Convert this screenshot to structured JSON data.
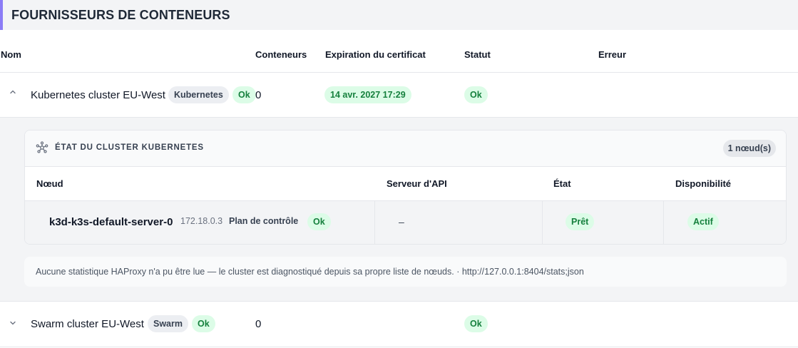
{
  "header": {
    "title": "FOURNISSEURS DE CONTENEURS"
  },
  "columns": {
    "name": "Nom",
    "containers": "Conteneurs",
    "cert_expiration": "Expiration du certificat",
    "status": "Statut",
    "error": "Erreur"
  },
  "providers": [
    {
      "name": "Kubernetes cluster EU-West",
      "type": "Kubernetes",
      "health": "Ok",
      "containers": "0",
      "cert_expiration": "14 avr. 2027 17:29",
      "status": "Ok",
      "expanded": true,
      "chevron": "chevron-up-icon"
    },
    {
      "name": "Swarm cluster EU-West",
      "type": "Swarm",
      "health": "Ok",
      "containers": "0",
      "status": "Ok",
      "expanded": false,
      "chevron": "chevron-down-icon"
    }
  ],
  "cluster_panel": {
    "icon": "cluster-icon",
    "title": "ÉTAT DU CLUSTER KUBERNETES",
    "node_count": "1 nœud(s)",
    "columns": {
      "node": "Nœud",
      "api_server": "Serveur d'API",
      "state": "État",
      "availability": "Disponibilité"
    },
    "nodes": [
      {
        "name": "k3d-k3s-default-server-0",
        "ip": "172.18.0.3",
        "role": "Plan de contrôle",
        "role_status": "Ok",
        "api_server": "–",
        "state": "Prêt",
        "availability": "Actif"
      }
    ],
    "note": "Aucune statistique HAProxy n'a pu être lue — le cluster est diagnostiqué depuis sa propre liste de nœuds. · http://127.0.0.1:8404/stats;json"
  },
  "colors": {
    "accent": "#8b7cf6",
    "ok_bg": "#dcfce7",
    "ok_text": "#15803d"
  }
}
